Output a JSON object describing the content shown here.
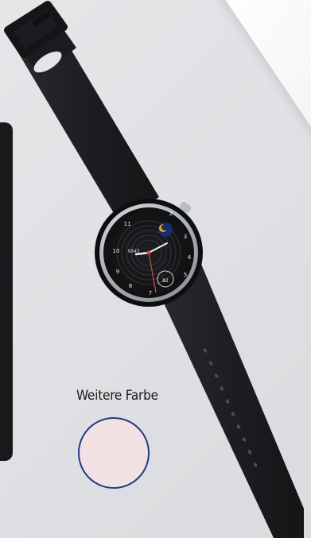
{
  "product": {
    "color_option_label": "Weitere Farbe",
    "swatch_color": "#f2e2e4",
    "swatch_border": "#243c82",
    "strap_color": "#1f2023",
    "case_color": "#c9ccd0",
    "dial_color": "#141416",
    "accent_color": "#d9463f"
  },
  "watch_face": {
    "steps": "6843",
    "heart_rate": "82",
    "hour_marks": [
      "2",
      "3",
      "4",
      "5",
      "7",
      "8",
      "9",
      "10",
      "11"
    ],
    "moon_icon": "moon-phase-icon"
  }
}
